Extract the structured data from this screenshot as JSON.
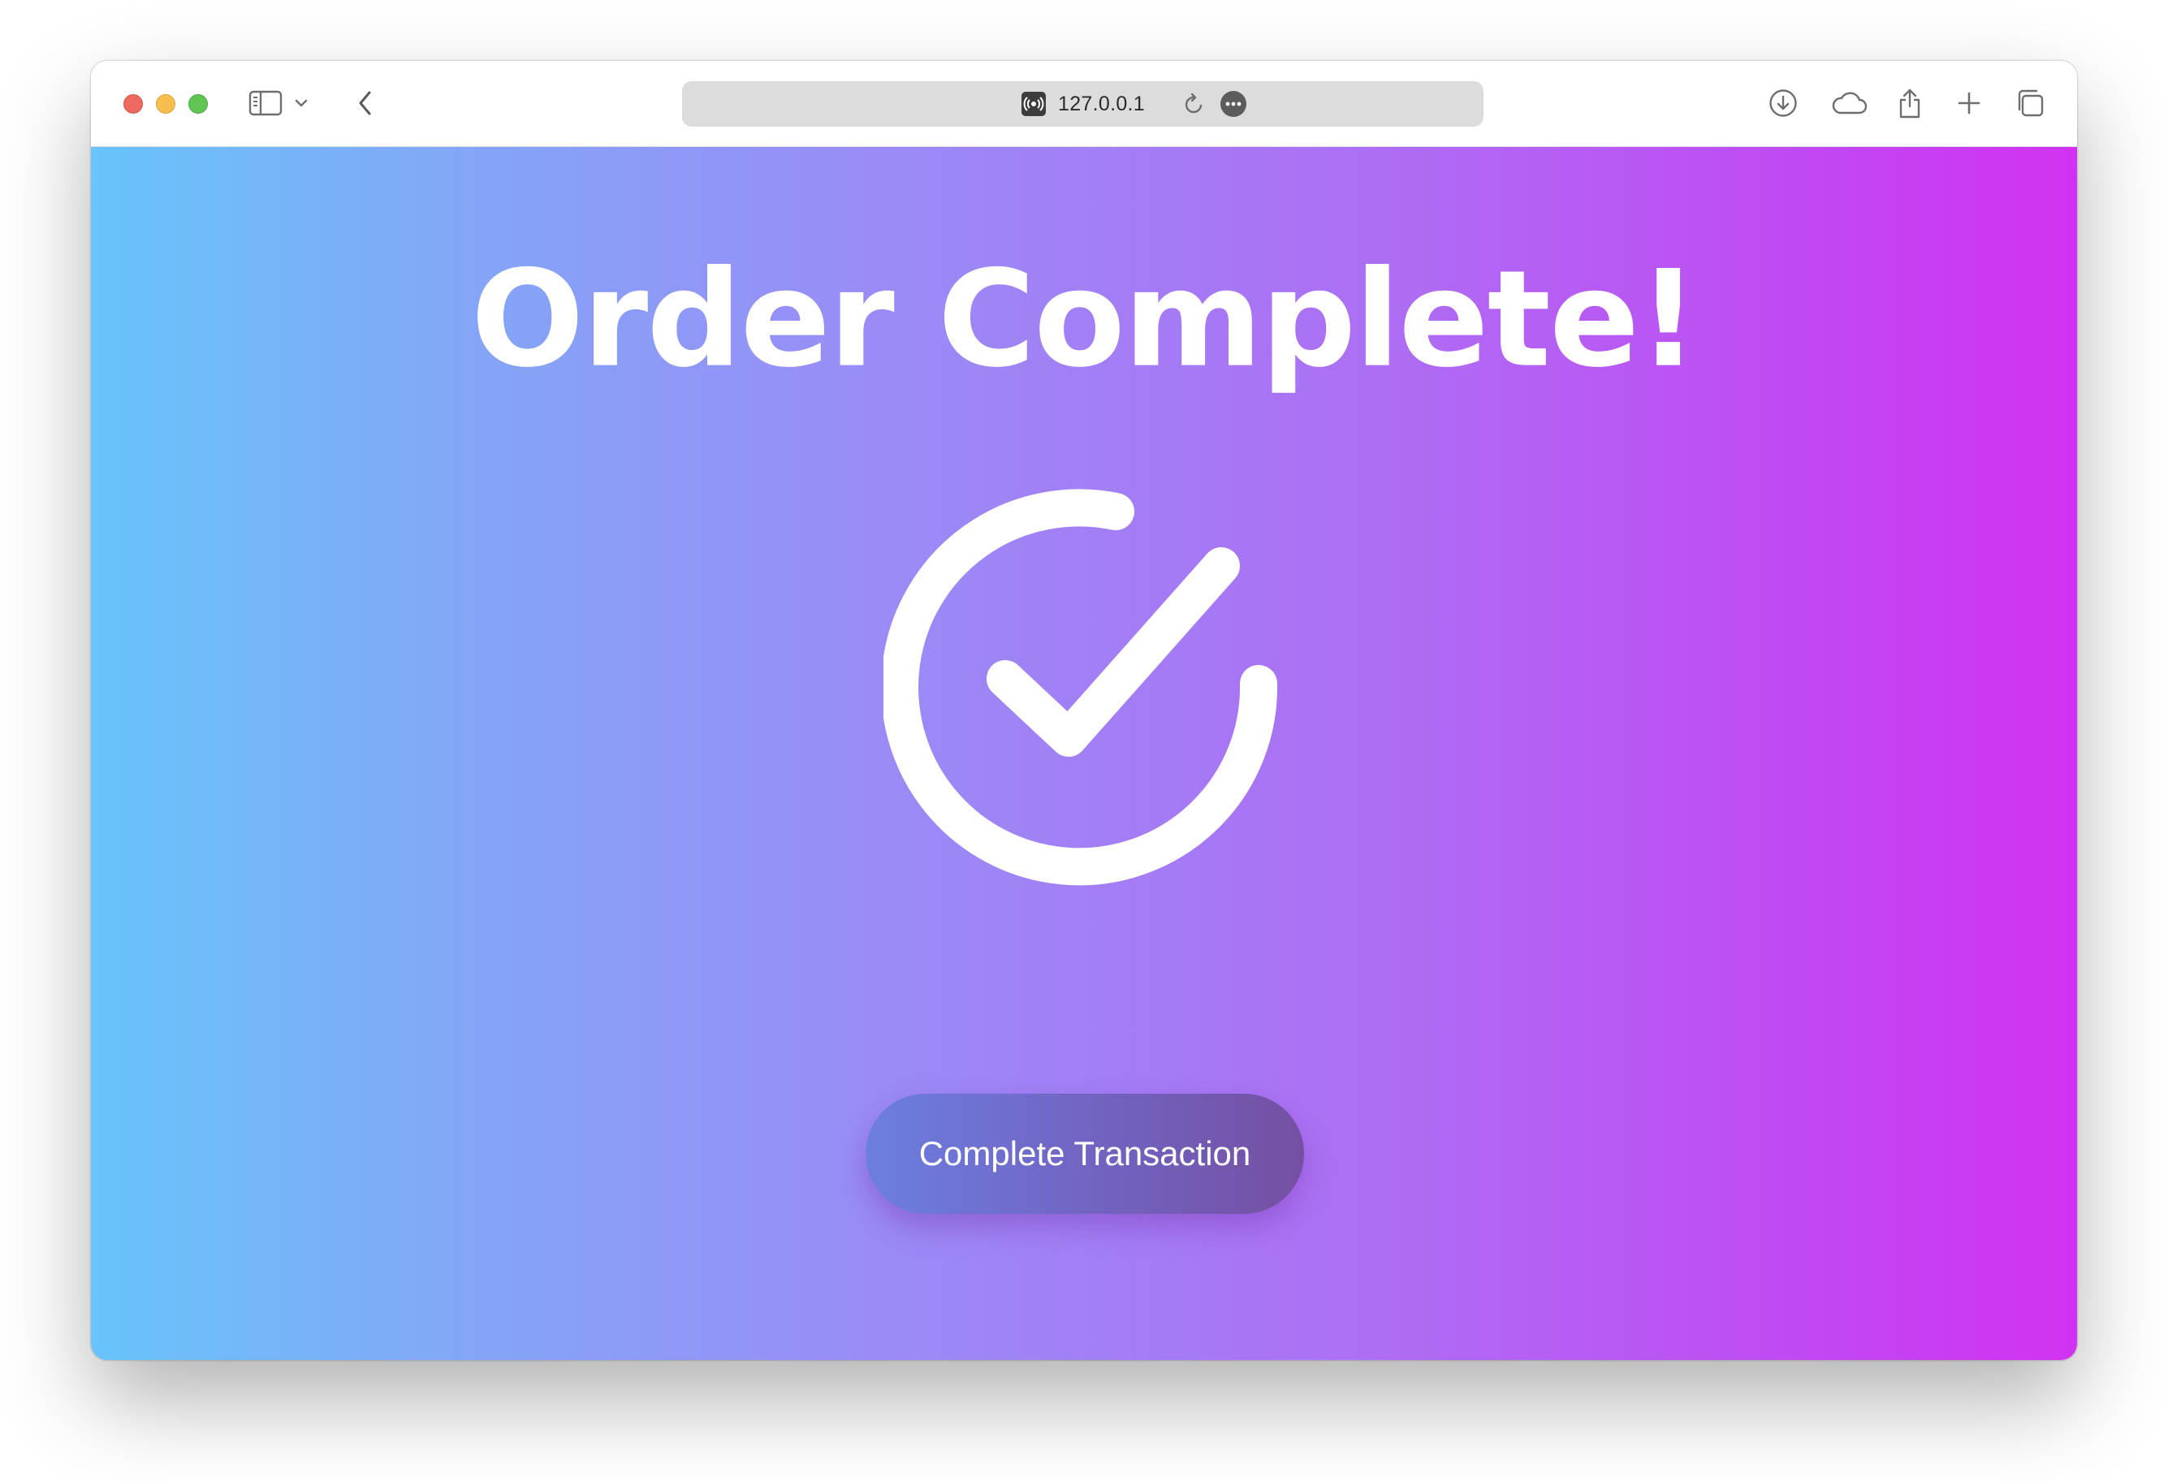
{
  "browser": {
    "url": "127.0.0.1",
    "icons": {
      "sidebar": "sidebar-icon",
      "chevron": "chevron-down-icon",
      "back": "back-arrow-icon",
      "site_settings": "site-settings-icon",
      "reload": "reload-icon",
      "more": "more-icon",
      "downloads": "download-icon",
      "icloud": "cloud-icon",
      "share": "share-icon",
      "new_tab": "plus-icon",
      "tabs": "tabs-overview-icon"
    }
  },
  "page": {
    "headline": "Order Complete!",
    "status_icon": "check-circle-icon",
    "button_label": "Complete Transaction",
    "colors": {
      "gradient_start": "#68c4fa",
      "gradient_mid": "#9a8bf6",
      "gradient_end": "#d132f1",
      "button_start": "#6b7fdf",
      "button_end": "#7450a2",
      "text": "#ffffff"
    }
  }
}
